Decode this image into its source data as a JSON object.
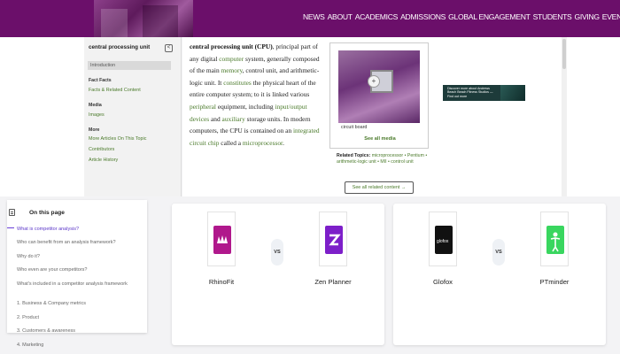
{
  "topnav": [
    "NEWS",
    "ABOUT",
    "ACADEMICS",
    "ADMISSIONS",
    "GLOBAL ENGAGEMENT",
    "STUDENTS",
    "GIVING",
    "EVENTS"
  ],
  "encyclopedia": {
    "sidebar_title": "central processing unit",
    "collapse_icon": "<",
    "intro": "Introduction",
    "group_facts": "Fact Facts",
    "facts_item": "Facts & Related Content",
    "group_media": "Media",
    "media_item": "Images",
    "group_more": "More",
    "more_items": [
      "More Articles On This Topic",
      "Contributors",
      "Article History"
    ]
  },
  "article": {
    "term": "central processing unit (CPU)",
    "t1": ", principal part of any digital ",
    "l1": "computer",
    "t2": " system, generally composed of the main ",
    "l2": "memory",
    "t3": ", control unit, and arithmetic-logic unit. It ",
    "l3": "constitutes",
    "t4": " the physical heart of the entire computer system; to it is linked various ",
    "l4": "peripheral",
    "t5": " equipment, including ",
    "l5": "input/output devices",
    "t6": " and ",
    "l6": "auxiliary",
    "t7": " storage units. In modern computers, the CPU is contained on an ",
    "l7": "integrated circuit chip",
    "t8": " called a ",
    "l8": "microprocessor",
    "t9": "."
  },
  "figure": {
    "caption": "circuit board",
    "see_all": "See all media",
    "zoom_icon": "+"
  },
  "related": {
    "label": "Related Topics:",
    "text": "microprocessor • Pentium • arithmetic-logic unit • MII • control unit",
    "button": "See all related content →"
  },
  "ad": {
    "text": "Discover more about Andrews Beach Beach Fitness Studios — Find out more"
  },
  "toc": {
    "title": "On this page",
    "items": [
      "What is competitor analysis?",
      "Who can benefit from an analysis framework?",
      "Why do it?",
      "Who even are your competitors?",
      "What's included in a competitor analysis framework",
      "1. Business & Company metrics",
      "2. Product",
      "3. Customers & awareness",
      "4. Marketing"
    ]
  },
  "comparisons": [
    {
      "left": "RhinoFit",
      "right": "Zen Planner",
      "vs": "VS"
    },
    {
      "left": "Glofox",
      "right": "PTminder",
      "vs": "VS"
    }
  ],
  "colors": {
    "brand_purple": "#6b0f6a",
    "link_green": "#4a7a2a",
    "rhinofit": "#b0188c",
    "zenplanner": "#7d1fc9",
    "glofox": "#111111",
    "ptminder": "#39d65f"
  }
}
